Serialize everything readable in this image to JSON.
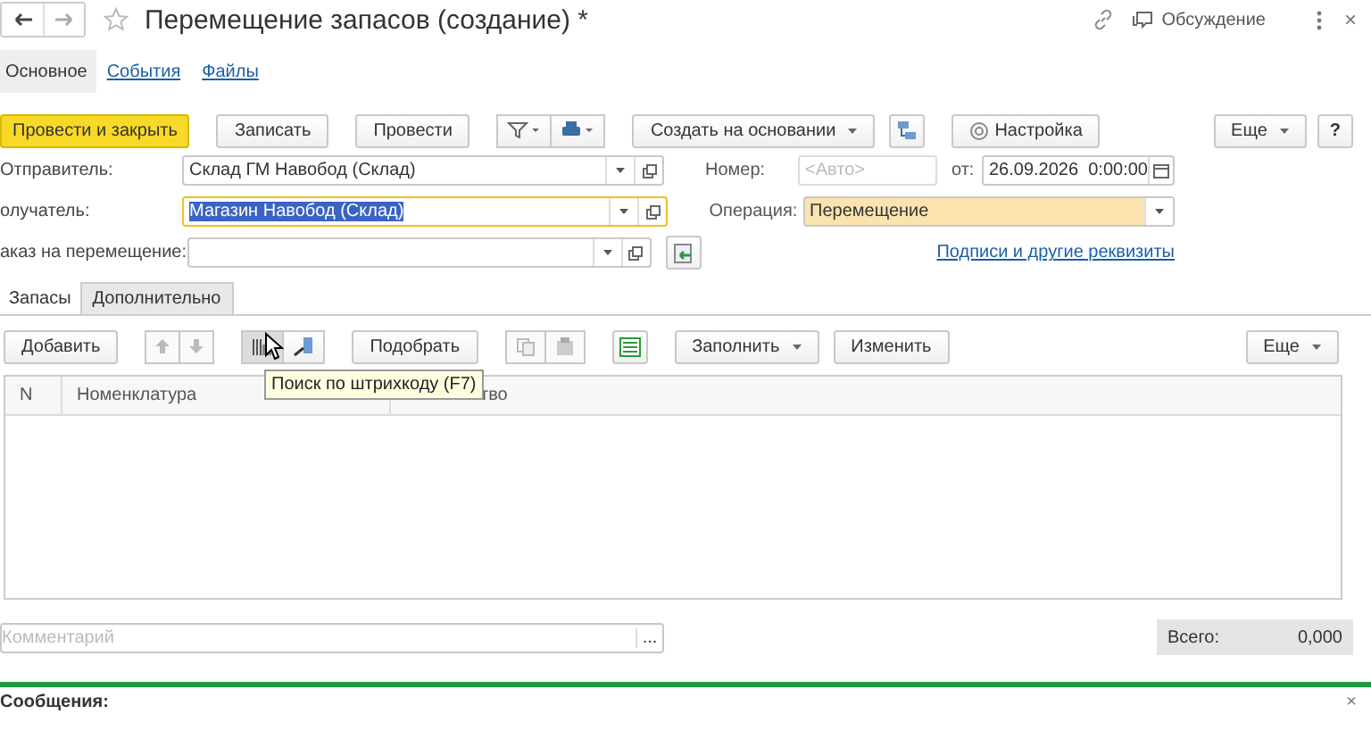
{
  "window": {
    "title": "Перемещение запасов (создание) *",
    "discussion": "Обсуждение",
    "close": "×"
  },
  "nav_tabs": [
    {
      "label": "Основное",
      "selected": true
    },
    {
      "label": "События",
      "selected": false
    },
    {
      "label": "Файлы",
      "selected": false
    }
  ],
  "toolbar": {
    "primary": "Провести и закрыть",
    "buttons": [
      "Записать",
      "Провести"
    ],
    "create_based": "Создать на основании",
    "settings": "Настройка",
    "more": "Еще",
    "help": "?"
  },
  "form": {
    "sender": {
      "label": "Отправитель:",
      "value": "Склад ГМ Навобод (Склад)",
      "focused": false
    },
    "receiver": {
      "label": "олучатель:",
      "value": "Магазин Навобод (Склад)",
      "focused": true
    },
    "order": {
      "label": "аказ на перемещение:"
    },
    "number": {
      "label": "Номер:",
      "placeholder": "<Авто>"
    },
    "date": {
      "label": "от:",
      "value": "26.09.2026  0:00:00"
    },
    "operation": {
      "label": "Операция:",
      "value": "Перемещение"
    },
    "signatures_link": "Подписи и другие реквизиты"
  },
  "section_tabs": [
    {
      "label": "Запасы",
      "selected": true
    },
    {
      "label": "Дополнительно",
      "selected": false
    }
  ],
  "table_toolbar": {
    "add": "Добавить",
    "pick": "Подобрать",
    "fill": "Заполнить",
    "edit": "Изменить",
    "more": "Еще"
  },
  "tooltip": "Поиск по штрихкоду (F7)",
  "table": {
    "columns": [
      "N",
      "Номенклатура",
      "тво"
    ]
  },
  "comment": {
    "placeholder": "Комментарий",
    "button": "..."
  },
  "total": {
    "label": "Всего:",
    "value": "0,000"
  },
  "messages": {
    "title": "Сообщения:",
    "close": "×"
  }
}
